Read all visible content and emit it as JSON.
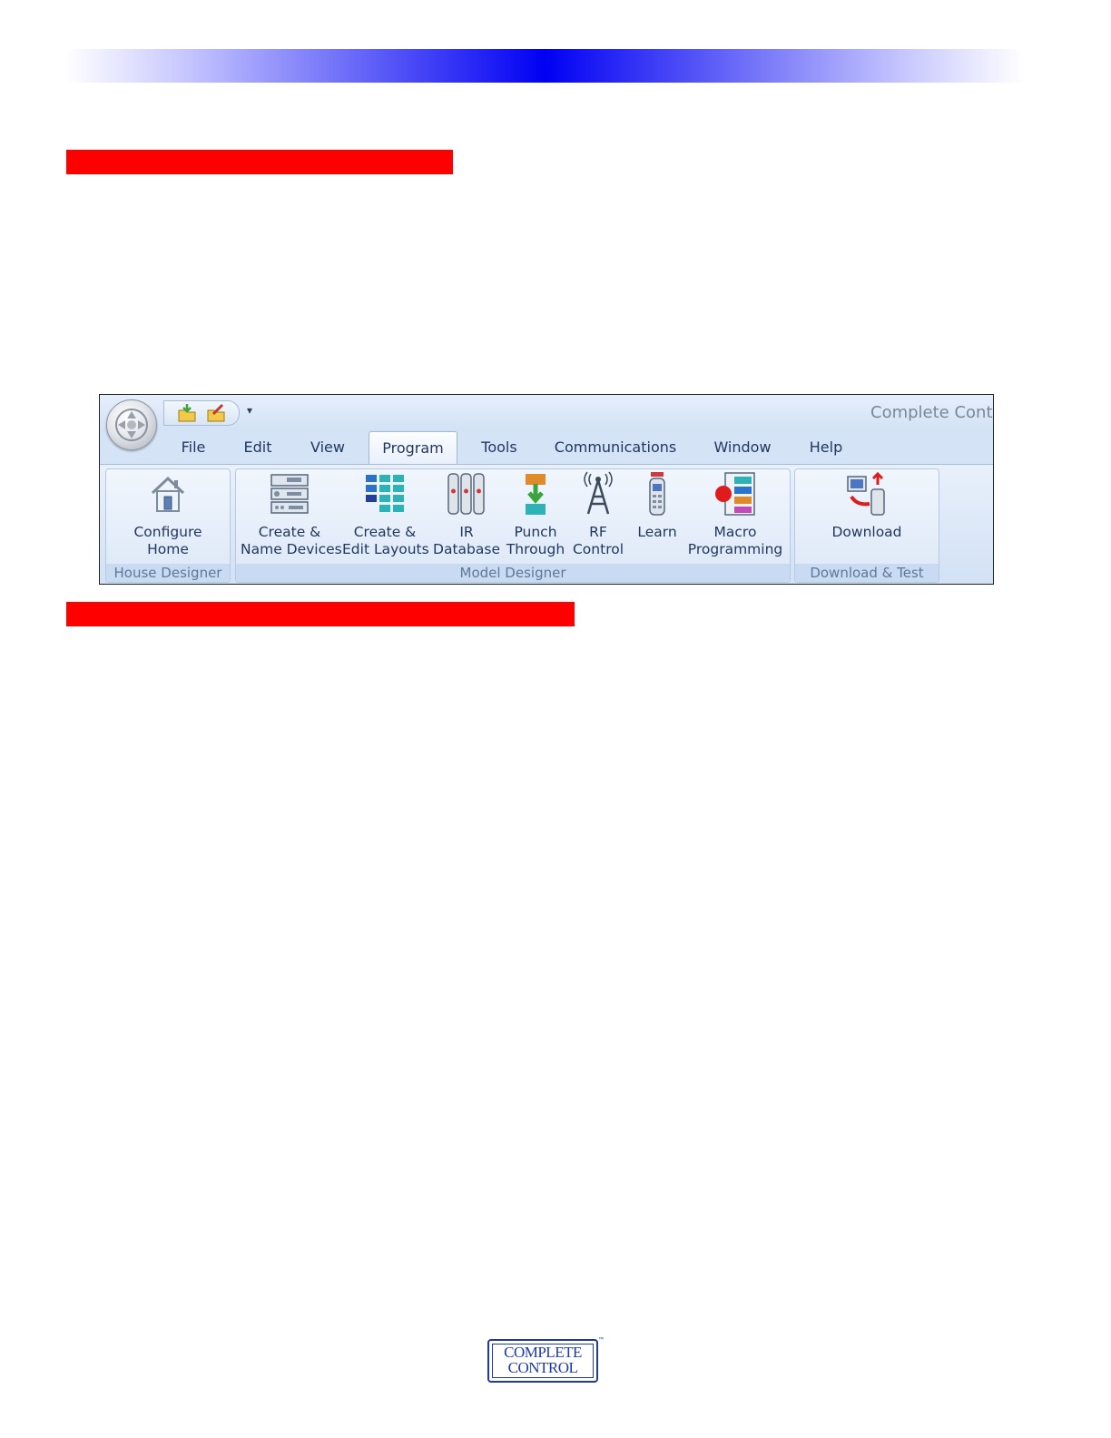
{
  "ribbon": {
    "app_title": "Complete Contr",
    "tabs": [
      {
        "label": "File"
      },
      {
        "label": "Edit"
      },
      {
        "label": "View"
      },
      {
        "label": "Program"
      },
      {
        "label": "Tools"
      },
      {
        "label": "Communications"
      },
      {
        "label": "Window"
      },
      {
        "label": "Help"
      }
    ],
    "qat_dropdown": "▾",
    "groups": {
      "house_designer": {
        "label": "House Designer",
        "buttons": [
          {
            "line1": "Configure",
            "line2": "Home",
            "icon": "house-icon"
          }
        ]
      },
      "model_designer": {
        "label": "Model Designer",
        "buttons": [
          {
            "line1": "Create &",
            "line2": "Name Devices",
            "icon": "devices-icon"
          },
          {
            "line1": "Create &",
            "line2": "Edit Layouts",
            "icon": "layouts-icon"
          },
          {
            "line1": "IR",
            "line2": "Database",
            "icon": "remotes-icon"
          },
          {
            "line1": "Punch",
            "line2": "Through",
            "icon": "punch-through-icon"
          },
          {
            "line1": "RF",
            "line2": "Control",
            "icon": "antenna-icon"
          },
          {
            "line1": "Learn",
            "line2": "",
            "icon": "learn-remote-icon"
          },
          {
            "line1": "Macro",
            "line2": "Programming",
            "icon": "macro-icon"
          }
        ]
      },
      "download_test": {
        "label": "Download & Test",
        "buttons": [
          {
            "line1": "Download",
            "line2": "",
            "icon": "download-icon"
          }
        ]
      }
    }
  },
  "logo": {
    "line1": "COMPLETE",
    "line2": "CONTROL",
    "tm": "™"
  },
  "colors": {
    "header_band": "#0000f4",
    "section_bar": "#ff0000",
    "logo": "#1f3aa8"
  }
}
